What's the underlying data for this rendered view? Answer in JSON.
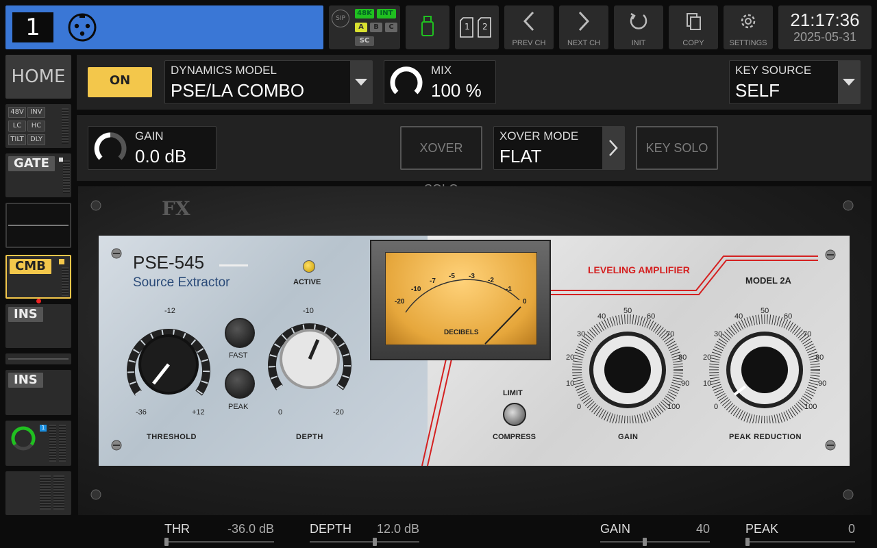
{
  "topbar": {
    "channel_number": "1",
    "sip_label": "SIP",
    "tags": {
      "rate": "48K",
      "clock": "INT",
      "a": "A",
      "b": "B",
      "c": "C",
      "sc": "SC"
    },
    "prev_ch": "PREV CH",
    "next_ch": "NEXT CH",
    "init": "INIT",
    "copy": "COPY",
    "settings": "SETTINGS",
    "layer_1": "1",
    "layer_2": "2",
    "time": "21:17:36",
    "date": "2025-05-31"
  },
  "strip": {
    "home": "HOME",
    "chips": [
      "48V",
      "INV",
      "LC",
      "HC",
      "TILT",
      "DLY"
    ],
    "gate": "GATE",
    "cmb": "CMB",
    "ins1": "INS",
    "ins2": "INS",
    "send_badge": "1"
  },
  "controls": {
    "on_label": "ON",
    "model_label": "DYNAMICS MODEL",
    "model_value": "PSE/LA COMBO",
    "mix_label": "MIX",
    "mix_value": "100 %",
    "key_source_label": "KEY SOURCE",
    "key_source_value": "SELF",
    "gain_label": "GAIN",
    "gain_value": "0.0 dB",
    "xover_solo": "XOVER SOLO",
    "xover_mode_label": "XOVER MODE",
    "xover_mode_value": "FLAT",
    "key_solo": "KEY SOLO"
  },
  "plugin": {
    "brand": "FX",
    "pse_title": "PSE-545",
    "pse_subtitle": "Source Extractor",
    "active": "ACTIVE",
    "threshold": {
      "label": "THRESHOLD",
      "top": "-12",
      "min": "-36",
      "max": "+12"
    },
    "fast": "FAST",
    "peak": "PEAK",
    "depth": {
      "label": "DEPTH",
      "top": "-10",
      "min": "0",
      "max": "-20"
    },
    "vu": {
      "caption": "DECIBELS",
      "ticks": [
        "-20",
        "-10",
        "-7",
        "-5",
        "-3",
        "-2",
        "-1",
        "0"
      ]
    },
    "la_title": "LEVELING AMPLIFIER",
    "la_model": "MODEL 2A",
    "limit": "LIMIT",
    "compress": "COMPRESS",
    "gain_label": "GAIN",
    "peak_reduction_label": "PEAK REDUCTION",
    "dial_ticks": [
      "0",
      "10",
      "20",
      "30",
      "40",
      "50",
      "60",
      "70",
      "80",
      "90",
      "100"
    ]
  },
  "params": [
    {
      "name": "THR",
      "value": "-36.0 dB",
      "position": 0.0
    },
    {
      "name": "DEPTH",
      "value": "12.0 dB",
      "position": 0.6
    },
    {
      "name": "GAIN",
      "value": "40",
      "position": 0.4
    },
    {
      "name": "PEAK",
      "value": "0",
      "position": 0.0
    }
  ],
  "colors": {
    "channel_blue": "#3a77d6",
    "on_yellow": "#f3c74b",
    "accent_green": "#20c020",
    "la_red": "#d42020"
  }
}
